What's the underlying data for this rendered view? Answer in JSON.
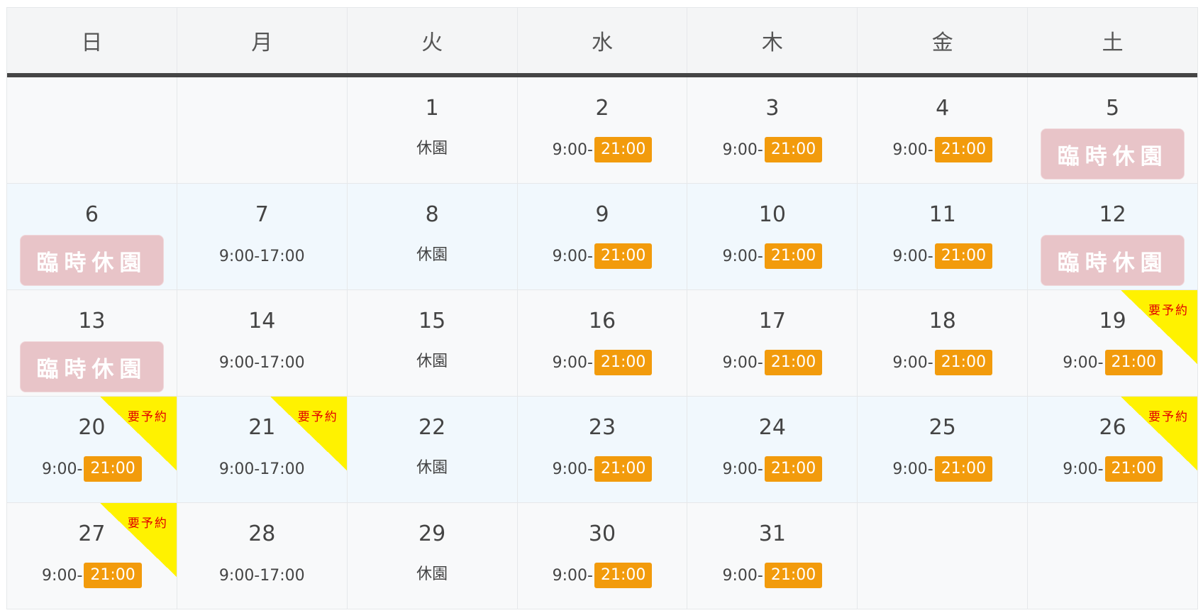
{
  "weekdays": [
    "日",
    "月",
    "火",
    "水",
    "木",
    "金",
    "土"
  ],
  "labels": {
    "closed": "休園",
    "temporary_closed": "臨時休園",
    "reservation_required": "要予約",
    "open_start": "9:00-",
    "open_end": "21:00",
    "short_hours": "9:00-17:00"
  },
  "colors": {
    "header_border": "#454545",
    "end_time_badge": "#f29b0c",
    "temporary_closed_badge": "#e8c4c8",
    "reservation_ribbon": "#fff200",
    "reservation_text": "#e10000"
  },
  "weeks": [
    [
      {
        "day": ""
      },
      {
        "day": ""
      },
      {
        "day": "1",
        "status": "closed"
      },
      {
        "day": "2",
        "status": "open"
      },
      {
        "day": "3",
        "status": "open"
      },
      {
        "day": "4",
        "status": "open"
      },
      {
        "day": "5",
        "status": "temporary_closed"
      }
    ],
    [
      {
        "day": "6",
        "status": "temporary_closed"
      },
      {
        "day": "7",
        "status": "short"
      },
      {
        "day": "8",
        "status": "closed"
      },
      {
        "day": "9",
        "status": "open"
      },
      {
        "day": "10",
        "status": "open"
      },
      {
        "day": "11",
        "status": "open"
      },
      {
        "day": "12",
        "status": "temporary_closed"
      }
    ],
    [
      {
        "day": "13",
        "status": "temporary_closed"
      },
      {
        "day": "14",
        "status": "short"
      },
      {
        "day": "15",
        "status": "closed"
      },
      {
        "day": "16",
        "status": "open"
      },
      {
        "day": "17",
        "status": "open"
      },
      {
        "day": "18",
        "status": "open"
      },
      {
        "day": "19",
        "status": "open",
        "reservation": true
      }
    ],
    [
      {
        "day": "20",
        "status": "open",
        "reservation": true
      },
      {
        "day": "21",
        "status": "short",
        "reservation": true
      },
      {
        "day": "22",
        "status": "closed"
      },
      {
        "day": "23",
        "status": "open"
      },
      {
        "day": "24",
        "status": "open"
      },
      {
        "day": "25",
        "status": "open"
      },
      {
        "day": "26",
        "status": "open",
        "reservation": true
      }
    ],
    [
      {
        "day": "27",
        "status": "open",
        "reservation": true
      },
      {
        "day": "28",
        "status": "short"
      },
      {
        "day": "29",
        "status": "closed"
      },
      {
        "day": "30",
        "status": "open"
      },
      {
        "day": "31",
        "status": "open"
      },
      {
        "day": ""
      },
      {
        "day": ""
      }
    ]
  ]
}
